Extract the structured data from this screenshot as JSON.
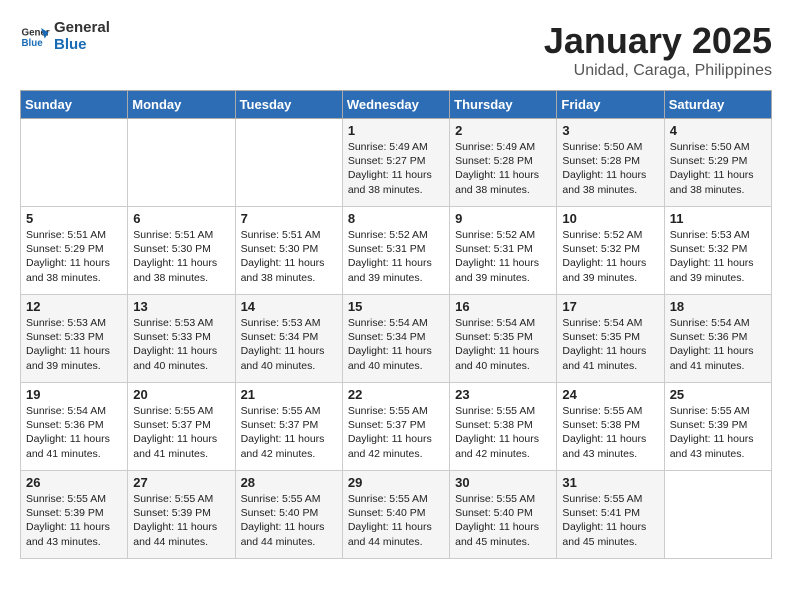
{
  "logo": {
    "line1": "General",
    "line2": "Blue"
  },
  "calendar": {
    "title": "January 2025",
    "subtitle": "Unidad, Caraga, Philippines"
  },
  "weekdays": [
    "Sunday",
    "Monday",
    "Tuesday",
    "Wednesday",
    "Thursday",
    "Friday",
    "Saturday"
  ],
  "weeks": [
    [
      {
        "day": "",
        "info": ""
      },
      {
        "day": "",
        "info": ""
      },
      {
        "day": "",
        "info": ""
      },
      {
        "day": "1",
        "info": "Sunrise: 5:49 AM\nSunset: 5:27 PM\nDaylight: 11 hours\nand 38 minutes."
      },
      {
        "day": "2",
        "info": "Sunrise: 5:49 AM\nSunset: 5:28 PM\nDaylight: 11 hours\nand 38 minutes."
      },
      {
        "day": "3",
        "info": "Sunrise: 5:50 AM\nSunset: 5:28 PM\nDaylight: 11 hours\nand 38 minutes."
      },
      {
        "day": "4",
        "info": "Sunrise: 5:50 AM\nSunset: 5:29 PM\nDaylight: 11 hours\nand 38 minutes."
      }
    ],
    [
      {
        "day": "5",
        "info": "Sunrise: 5:51 AM\nSunset: 5:29 PM\nDaylight: 11 hours\nand 38 minutes."
      },
      {
        "day": "6",
        "info": "Sunrise: 5:51 AM\nSunset: 5:30 PM\nDaylight: 11 hours\nand 38 minutes."
      },
      {
        "day": "7",
        "info": "Sunrise: 5:51 AM\nSunset: 5:30 PM\nDaylight: 11 hours\nand 38 minutes."
      },
      {
        "day": "8",
        "info": "Sunrise: 5:52 AM\nSunset: 5:31 PM\nDaylight: 11 hours\nand 39 minutes."
      },
      {
        "day": "9",
        "info": "Sunrise: 5:52 AM\nSunset: 5:31 PM\nDaylight: 11 hours\nand 39 minutes."
      },
      {
        "day": "10",
        "info": "Sunrise: 5:52 AM\nSunset: 5:32 PM\nDaylight: 11 hours\nand 39 minutes."
      },
      {
        "day": "11",
        "info": "Sunrise: 5:53 AM\nSunset: 5:32 PM\nDaylight: 11 hours\nand 39 minutes."
      }
    ],
    [
      {
        "day": "12",
        "info": "Sunrise: 5:53 AM\nSunset: 5:33 PM\nDaylight: 11 hours\nand 39 minutes."
      },
      {
        "day": "13",
        "info": "Sunrise: 5:53 AM\nSunset: 5:33 PM\nDaylight: 11 hours\nand 40 minutes."
      },
      {
        "day": "14",
        "info": "Sunrise: 5:53 AM\nSunset: 5:34 PM\nDaylight: 11 hours\nand 40 minutes."
      },
      {
        "day": "15",
        "info": "Sunrise: 5:54 AM\nSunset: 5:34 PM\nDaylight: 11 hours\nand 40 minutes."
      },
      {
        "day": "16",
        "info": "Sunrise: 5:54 AM\nSunset: 5:35 PM\nDaylight: 11 hours\nand 40 minutes."
      },
      {
        "day": "17",
        "info": "Sunrise: 5:54 AM\nSunset: 5:35 PM\nDaylight: 11 hours\nand 41 minutes."
      },
      {
        "day": "18",
        "info": "Sunrise: 5:54 AM\nSunset: 5:36 PM\nDaylight: 11 hours\nand 41 minutes."
      }
    ],
    [
      {
        "day": "19",
        "info": "Sunrise: 5:54 AM\nSunset: 5:36 PM\nDaylight: 11 hours\nand 41 minutes."
      },
      {
        "day": "20",
        "info": "Sunrise: 5:55 AM\nSunset: 5:37 PM\nDaylight: 11 hours\nand 41 minutes."
      },
      {
        "day": "21",
        "info": "Sunrise: 5:55 AM\nSunset: 5:37 PM\nDaylight: 11 hours\nand 42 minutes."
      },
      {
        "day": "22",
        "info": "Sunrise: 5:55 AM\nSunset: 5:37 PM\nDaylight: 11 hours\nand 42 minutes."
      },
      {
        "day": "23",
        "info": "Sunrise: 5:55 AM\nSunset: 5:38 PM\nDaylight: 11 hours\nand 42 minutes."
      },
      {
        "day": "24",
        "info": "Sunrise: 5:55 AM\nSunset: 5:38 PM\nDaylight: 11 hours\nand 43 minutes."
      },
      {
        "day": "25",
        "info": "Sunrise: 5:55 AM\nSunset: 5:39 PM\nDaylight: 11 hours\nand 43 minutes."
      }
    ],
    [
      {
        "day": "26",
        "info": "Sunrise: 5:55 AM\nSunset: 5:39 PM\nDaylight: 11 hours\nand 43 minutes."
      },
      {
        "day": "27",
        "info": "Sunrise: 5:55 AM\nSunset: 5:39 PM\nDaylight: 11 hours\nand 44 minutes."
      },
      {
        "day": "28",
        "info": "Sunrise: 5:55 AM\nSunset: 5:40 PM\nDaylight: 11 hours\nand 44 minutes."
      },
      {
        "day": "29",
        "info": "Sunrise: 5:55 AM\nSunset: 5:40 PM\nDaylight: 11 hours\nand 44 minutes."
      },
      {
        "day": "30",
        "info": "Sunrise: 5:55 AM\nSunset: 5:40 PM\nDaylight: 11 hours\nand 45 minutes."
      },
      {
        "day": "31",
        "info": "Sunrise: 5:55 AM\nSunset: 5:41 PM\nDaylight: 11 hours\nand 45 minutes."
      },
      {
        "day": "",
        "info": ""
      }
    ]
  ]
}
